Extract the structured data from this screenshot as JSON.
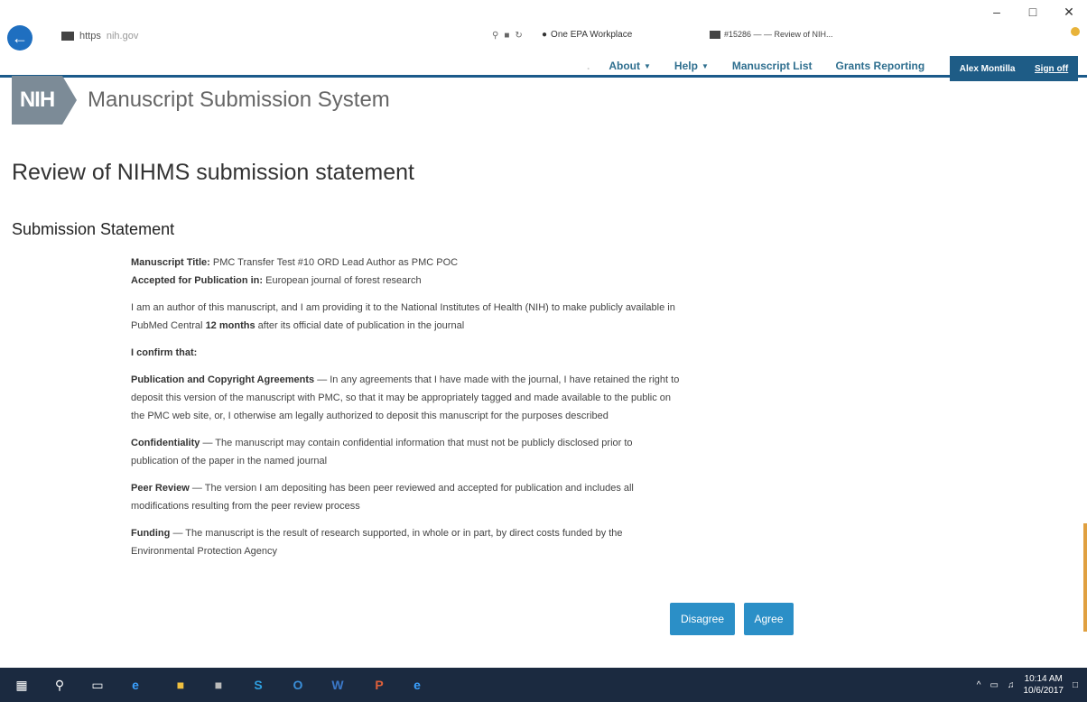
{
  "browser": {
    "url_scheme": "https",
    "url_rest": "nih.gov",
    "favorites_tab": "One EPA Workplace",
    "page_tab": "#15286 — — Review of NIH..."
  },
  "nav": {
    "about": "About",
    "help": "Help",
    "manuscript_list": "Manuscript List",
    "grants_reporting": "Grants Reporting",
    "user_name": "Alex Montilla",
    "sign_off": "Sign off"
  },
  "logo": {
    "nih": "NIH",
    "system_name": "Manuscript Submission System"
  },
  "page_title": "Review of NIHMS submission statement",
  "section_title": "Submission Statement",
  "statement": {
    "title_label": "Manuscript Title:",
    "title_value": "PMC Transfer Test #10 ORD Lead Author as PMC POC",
    "accepted_label": "Accepted for Publication in:",
    "accepted_value": "European journal of forest research",
    "intro_pre": "I am an author of this manuscript, and I am providing it to the National Institutes of Health (NIH) to make publicly available in PubMed Central",
    "intro_bold": "12 months",
    "intro_post": "after its official date of publication in the journal",
    "confirm": "I confirm that:",
    "pub_label": "Publication and Copyright Agreements",
    "pub_text": "— In any agreements that I have made with the journal, I have retained the right to deposit this version of the manuscript with PMC, so that it may be appropriately tagged and made available to the public on the PMC web site, or, I otherwise am legally authorized to deposit this manuscript for the purposes described",
    "conf_label": "Confidentiality",
    "conf_text": "— The manuscript may contain confidential information that must not be publicly disclosed prior to publication of the paper in the named journal",
    "peer_label": "Peer Review",
    "peer_text": "— The version I am depositing has been peer reviewed and accepted for publication and includes all modifications resulting from the peer review process",
    "fund_label": "Funding",
    "fund_text": "— The manuscript is the result of research supported, in whole or in part, by direct costs funded by the Environmental Protection Agency"
  },
  "buttons": {
    "disagree": "Disagree",
    "agree": "Agree"
  },
  "taskbar": {
    "time": "10:14 AM",
    "date": "10/6/2017"
  }
}
